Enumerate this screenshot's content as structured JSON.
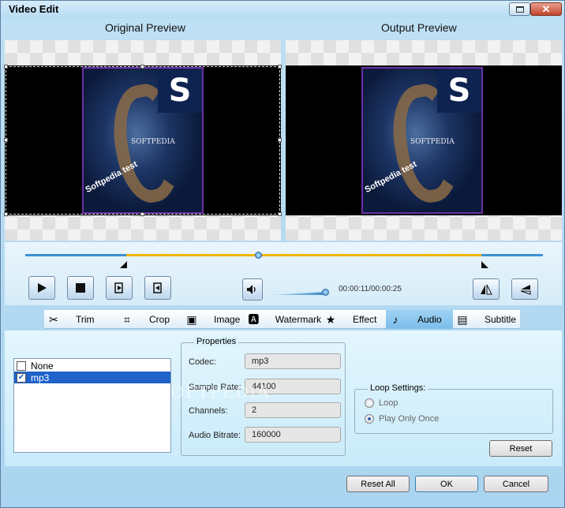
{
  "window": {
    "title": "Video Edit"
  },
  "previews": {
    "original_label": "Original Preview",
    "output_label": "Output Preview",
    "poster_brand": "SOFTPEDIA",
    "poster_caption": "Softpedia test",
    "poster_logo_letter": "S"
  },
  "playback": {
    "time_display": "00:00:11/00:00:25",
    "timeline_position": 0.44,
    "volume_level": 1.0
  },
  "tabs": [
    {
      "label": "Trim",
      "icon": "scissors-icon"
    },
    {
      "label": "Crop",
      "icon": "crop-icon"
    },
    {
      "label": "Image",
      "icon": "image-icon"
    },
    {
      "label": "Watermark",
      "icon": "watermark-icon"
    },
    {
      "label": "Effect",
      "icon": "star-icon"
    },
    {
      "label": "Audio",
      "icon": "music-note-icon"
    },
    {
      "label": "Subtitle",
      "icon": "subtitle-icon"
    }
  ],
  "active_tab": "Audio",
  "audio_tracks": [
    {
      "label": "None",
      "checked": false,
      "selected": false
    },
    {
      "label": "mp3",
      "checked": true,
      "selected": true
    }
  ],
  "properties": {
    "legend": "Properties",
    "codec_label": "Codec:",
    "codec_value": "mp3",
    "sample_rate_label": "Sample Rate:",
    "sample_rate_value": "44100",
    "channels_label": "Channels:",
    "channels_value": "2",
    "bitrate_label": "Audio Bitrate:",
    "bitrate_value": "160000"
  },
  "loop_settings": {
    "legend": "Loop Settings:",
    "loop_label": "Loop",
    "play_once_label": "Play Only Once",
    "selected": "Play Only Once"
  },
  "buttons": {
    "reset": "Reset",
    "reset_all": "Reset All",
    "ok": "OK",
    "cancel": "Cancel"
  },
  "watermark_text": "SOFTPEDIA",
  "colors": {
    "accent": "#1f62c9",
    "timeline_selection": "#f0b400",
    "timeline_track": "#3c8fd2",
    "active_tab": "#8ccaf0"
  }
}
